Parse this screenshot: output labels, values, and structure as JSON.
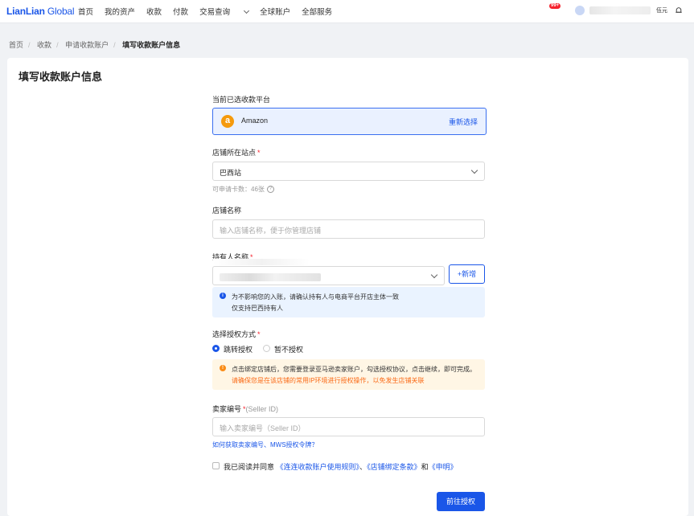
{
  "header": {
    "logo": "LianLian",
    "logo_suffix": " Global",
    "nav": [
      "首页",
      "我的资产",
      "收款",
      "付款",
      "交易查询",
      "全球账户",
      "全部服务"
    ],
    "icons": [
      "help-icon",
      "wallet-icon",
      "calendar-icon",
      "language-icon",
      "bell-icon"
    ],
    "lang_label": "伍元",
    "bell_badge": "99+"
  },
  "breadcrumb": [
    "首页",
    "收款",
    "申请收款账户",
    "填写收款账户信息"
  ],
  "page": {
    "title": "填写收款账户信息"
  },
  "form": {
    "platform_label": "当前已选收款平台",
    "platform_letter": "a",
    "platform_name": "Amazon",
    "reselect": "重新选择",
    "site_label": "店铺所在站点",
    "site_value": "巴西站",
    "site_hint": "可申请卡数：46张",
    "shop_name_label": "店铺名称",
    "shop_name_placeholder": "输入店铺名称，便于你管理店铺",
    "holder_label": "持有人名称",
    "add_button": "新增",
    "holder_notice_1": "为不影响您的入账，请确认持有人与电商平台开店主体一致",
    "holder_notice_2": "仅支持巴西持有人",
    "auth_label": "选择授权方式",
    "auth_options": [
      "跳转授权",
      "暂不授权"
    ],
    "auth_notice_1": "点击绑定店铺后，您需要登录亚马逊卖家账户，勾选授权协议，点击继续，即可完成。",
    "auth_notice_2": "请确保您是在该店铺的常用IP环境进行授权操作，以免发生店铺关联",
    "seller_label": "卖家编号",
    "seller_sub": "(Seller ID)",
    "seller_placeholder": "输入卖家编号（Seller ID）",
    "seller_help": "如何获取卖家编号、MWS授权令牌？",
    "agree_prefix": "我已阅读并同意",
    "agree_link1": "《连连收款账户使用规则》",
    "agree_sep": "、",
    "agree_link2": "《店铺绑定条款》",
    "agree_and": "和",
    "agree_link3": "《申明》",
    "submit": "前往授权"
  },
  "colors": {
    "primary": "#1a56e8",
    "warning": "#fa8c16",
    "required": "#f5222d"
  }
}
